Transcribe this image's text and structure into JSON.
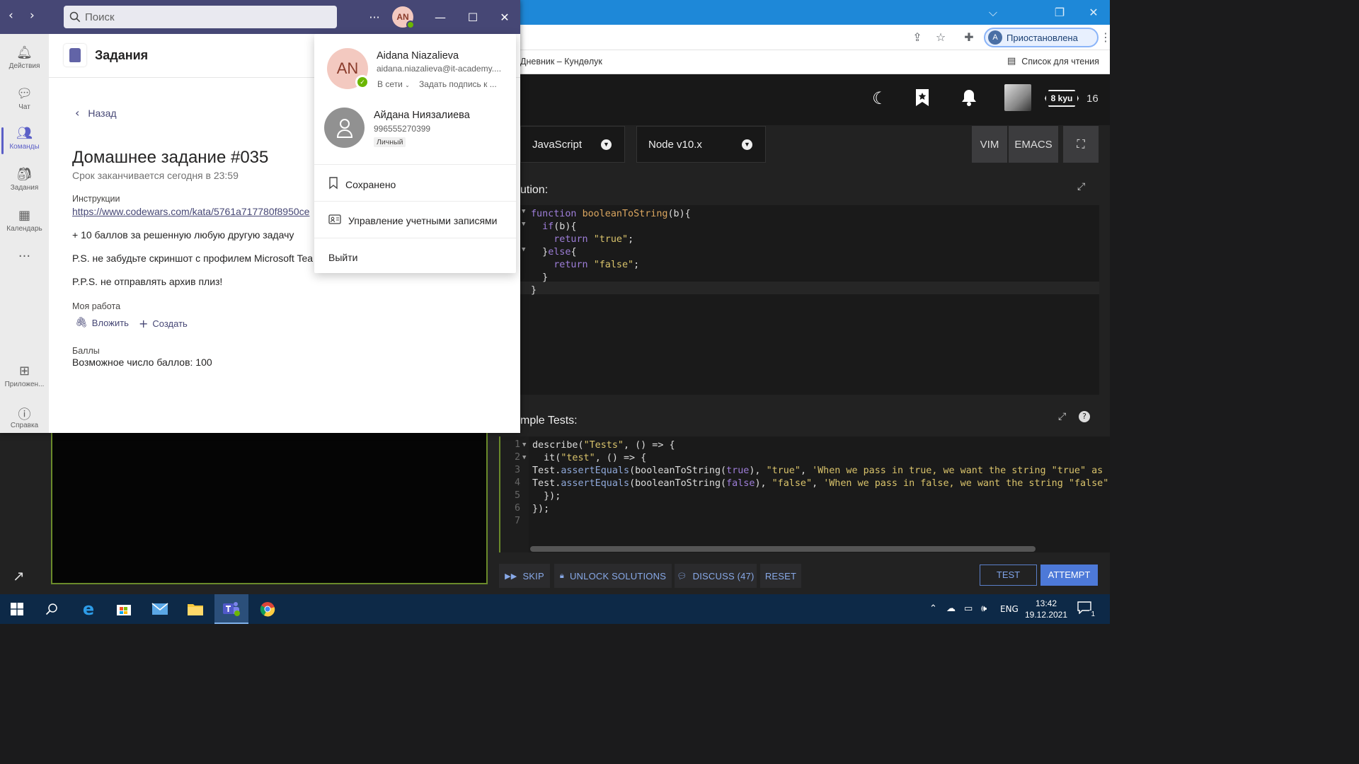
{
  "chrome": {
    "profile_initial": "A",
    "profile_label": "Приостановлена",
    "tab_bookmark": "Дневник – Кундөлук",
    "reading_list": "Список для чтения"
  },
  "codewars": {
    "rank": "8 kyu",
    "honor": "16",
    "language": "JavaScript",
    "runtime": "Node v10.x",
    "vim": "VIM",
    "emacs": "EMACS",
    "solution_label": "ution:",
    "tests_label": "mple Tests:",
    "solution_lines": [
      "function booleanToString(b){",
      "  if(b){",
      "    return \"true\";",
      "  }else{",
      "    return \"false\";",
      "  }",
      "}"
    ],
    "test_lines": [
      "describe(\"Tests\", () => {",
      "  it(\"test\", () => {",
      "Test.assertEquals(booleanToString(true), \"true\", 'When we pass in true, we want the string \"true\" as o",
      "Test.assertEquals(booleanToString(false), \"false\", 'When we pass in false, we want the string \"false\" ",
      "  });",
      "});",
      ""
    ],
    "line_numbers": [
      "1",
      "2",
      "3",
      "4",
      "5",
      "6",
      "7"
    ],
    "actions": {
      "skip": "SKIP",
      "unlock": "UNLOCK SOLUTIONS",
      "discuss": "DISCUSS (47)",
      "reset": "RESET",
      "test": "TEST",
      "attempt": "ATTEMPT"
    }
  },
  "teams": {
    "search_placeholder": "Поиск",
    "avatar_initials": "AN",
    "rail": [
      {
        "label": "Действия",
        "icon": "bell-icon"
      },
      {
        "label": "Чат",
        "icon": "chat-icon"
      },
      {
        "label": "Команды",
        "icon": "teams-icon"
      },
      {
        "label": "Задания",
        "icon": "assignments-icon"
      },
      {
        "label": "Календарь",
        "icon": "calendar-icon"
      },
      {
        "label": "Приложен...",
        "icon": "apps-icon"
      },
      {
        "label": "Справка",
        "icon": "help-icon"
      }
    ],
    "app_title": "Задания",
    "back": "Назад",
    "hw_title": "Домашнее задание #035",
    "due": "Срок заканчивается сегодня в 23:59",
    "instructions_label": "Инструкции",
    "instructions_link": "https://www.codewars.com/kata/5761a717780f8950ce",
    "line1": "+ 10 баллов за решенную любую другую задачу",
    "line2": "P.S. не забудьте скриншот с профилем Microsoft Tea",
    "line3": "P.P.S. не отправлять архив плиз!",
    "my_work_label": "Моя работа",
    "attach": "Вложить",
    "create": "Создать",
    "points_label": "Баллы",
    "points_value": "Возможное число баллов: 100",
    "accent": "#464775"
  },
  "profile_menu": {
    "initials": "AN",
    "name": "Aidana Niazalieva",
    "email": "aidana.niazalieva@it-academy....",
    "status": "В сети",
    "status_message": "Задать подпись к ...",
    "name2": "Айдана Ниязалиева",
    "phone": "996555270399",
    "badge": "Личный",
    "saved": "Сохранено",
    "manage": "Управление учетными записями",
    "signout": "Выйти"
  },
  "taskbar": {
    "lang": "ENG",
    "time": "13:42",
    "date": "19.12.2021",
    "notifications": "1"
  }
}
